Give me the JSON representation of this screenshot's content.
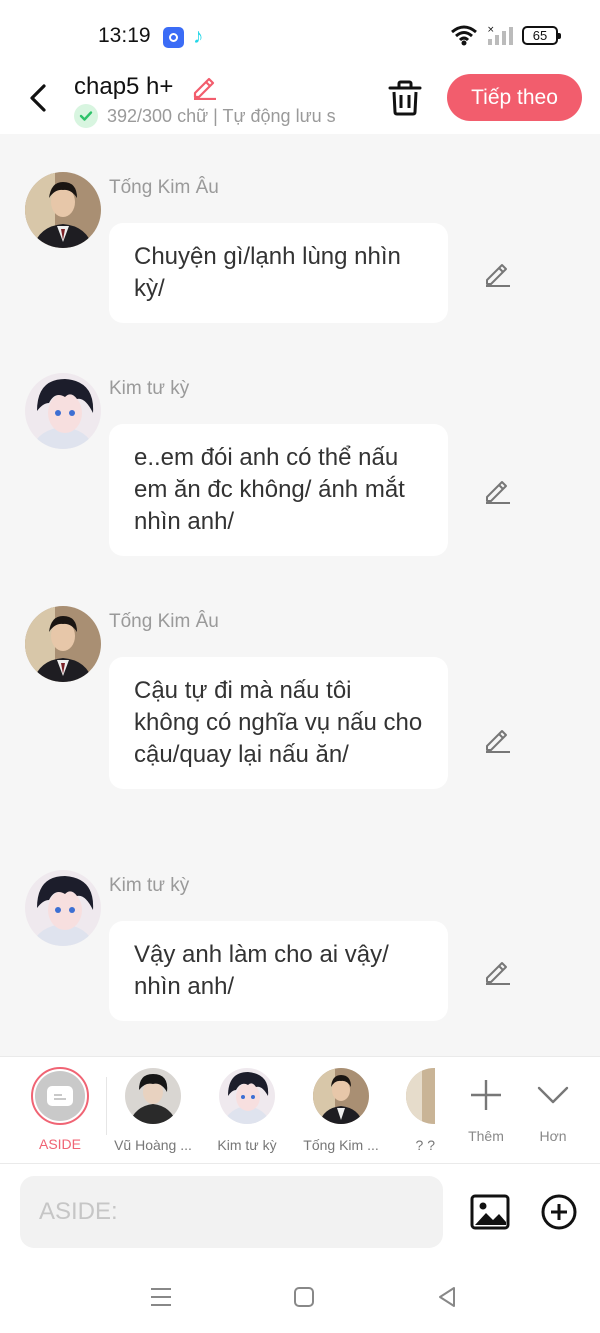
{
  "status_bar": {
    "time": "13:19",
    "battery": "65"
  },
  "header": {
    "title": "chap5 h+",
    "subtitle": "392/300 chữ | Tự động lưu s",
    "next_label": "Tiếp theo"
  },
  "messages": [
    {
      "name": "Tống Kim Âu",
      "text": "Chuyện gì/lạnh lùng nhìn kỳ/"
    },
    {
      "name": "Kim tư kỳ",
      "text": "e..em đói anh có thể nấu em ăn đc không/ ánh mắt nhìn anh/"
    },
    {
      "name": "Tống Kim Âu",
      "text": "Cậu tự đi mà nấu tôi không có nghĩa vụ nấu cho cậu/quay lại nấu ăn/"
    },
    {
      "name": "Kim tư kỳ",
      "text": "Vậy anh làm cho ai vậy/ nhìn anh/"
    }
  ],
  "characters": {
    "aside_label": "ASIDE",
    "items": [
      {
        "label": "Vũ Hoàng ..."
      },
      {
        "label": "Kim tư kỳ"
      },
      {
        "label": "Tống Kim ..."
      },
      {
        "label": "? ?"
      }
    ],
    "more_label": "Thêm",
    "expand_label": "Hơn"
  },
  "input": {
    "placeholder": "ASIDE:"
  },
  "colors": {
    "accent": "#f25d6d",
    "background": "#f6f6f6",
    "check": "#2ec26a"
  }
}
